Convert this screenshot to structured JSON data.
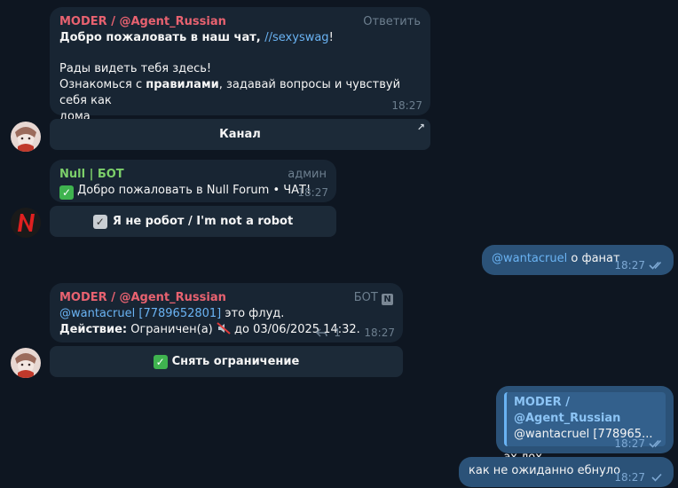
{
  "messages": {
    "welcome": {
      "sender": "MODER / @Agent_Russian",
      "reply_label": "Ответить",
      "line1_bold": "Добро пожаловать в  наш чат, ",
      "line1_link": "//sexyswag",
      "line1_end": "!",
      "line2": "Рады видеть тебя здесь!",
      "line3_pre": "Ознакомься с ",
      "line3_bold": "правилами",
      "line3_post": ", задавай вопросы и чувствуй себя как",
      "line4": "дома",
      "time": "18:27",
      "button": "Канал"
    },
    "null_bot": {
      "sender": "Null | БОТ",
      "tag": "админ",
      "text": "Добро пожаловать в Null Forum • ЧАТ!",
      "time": "18:27",
      "button": "Я не робот / I'm not a robot"
    },
    "out_fan": {
      "mention": "@wantacruel",
      "text": " о фанат",
      "time": "18:27"
    },
    "flood": {
      "sender": "MODER / @Agent_Russian",
      "tag": "БОТ",
      "tag_badge": "N",
      "mention": "@wantacruel",
      "user_id": "[7789652801]",
      "line1_post": " это флуд.",
      "action_label": "Действие:",
      "action_text": " Ограничен(а) ",
      "action_until": " до 03/06/2025 14:32.",
      "replies": "1",
      "time": "18:27",
      "button": "Снять ограничение"
    },
    "out_reply": {
      "quote_name": "MODER / @Agent_Russian",
      "quote_text": "@wantacruel [778965...",
      "text": "эх лох",
      "time": "18:27"
    },
    "out_last": {
      "text": "как не ожиданно ебнуло",
      "time": "18:27"
    }
  },
  "colors": {
    "background": "#0e1621",
    "incoming": "#182533",
    "outgoing": "#2b5278",
    "accent": "#6ab3f3",
    "moder_name": "#e86270",
    "bot_name": "#7ccf6a"
  },
  "icons": {
    "check_emoji": "check-mark-button-icon",
    "gray_check": "ballot-box-check-icon",
    "reply": "reply-arrow-icon",
    "ticks": "double-check-icon",
    "corner_arrow": "open-link-arrow-icon"
  }
}
